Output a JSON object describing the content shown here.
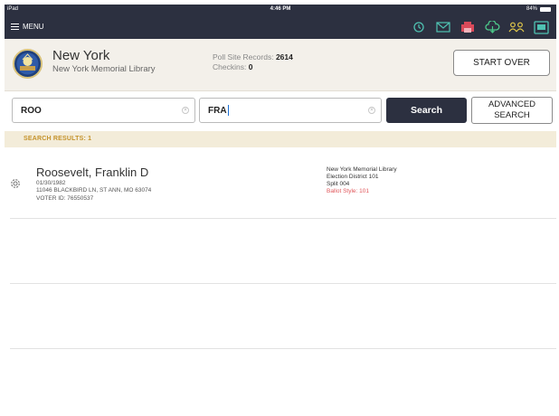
{
  "status_bar": {
    "device": "iPad",
    "time": "4:46 PM",
    "battery": "84%"
  },
  "nav": {
    "menu_label": "MENU",
    "icons": [
      "sync-icon",
      "mail-icon",
      "printer-icon",
      "cloud-icon",
      "users-icon",
      "chat-icon"
    ]
  },
  "header": {
    "site_name": "New York",
    "site_subtitle": "New York Memorial Library",
    "poll_site_records_label": "Poll Site Records:",
    "poll_site_records_value": "2614",
    "checkins_label": "Checkins:",
    "checkins_value": "0",
    "start_over_label": "START OVER"
  },
  "search": {
    "field1_value": "ROO",
    "field2_value": "FRA",
    "search_label": "Search",
    "advanced_line1": "ADVANCED",
    "advanced_line2": "SEARCH"
  },
  "results": {
    "label": "SEARCH RESULTS: 1",
    "items": [
      {
        "name": "Roosevelt, Franklin D",
        "dob": "01/30/1982",
        "address": "11046 BLACKBIRD LN, ST ANN, MO 63074",
        "voter_id": "VOTER ID: 76550537",
        "poll_site": "New York Memorial Library",
        "district": "Election District 101",
        "split": "Split 004",
        "ballot_style": "Ballot Style: 101"
      }
    ]
  },
  "colors": {
    "nav_bg": "#2c3040",
    "header_bg": "#f3f0ea",
    "results_bar_bg": "#f3ecd9",
    "results_label": "#c4922a",
    "ballot_style": "#e0565a",
    "icon_teal": "#4fc2b2",
    "icon_yellow": "#e3c94a",
    "icon_red": "#d94a5a",
    "icon_green": "#4cc98a"
  }
}
